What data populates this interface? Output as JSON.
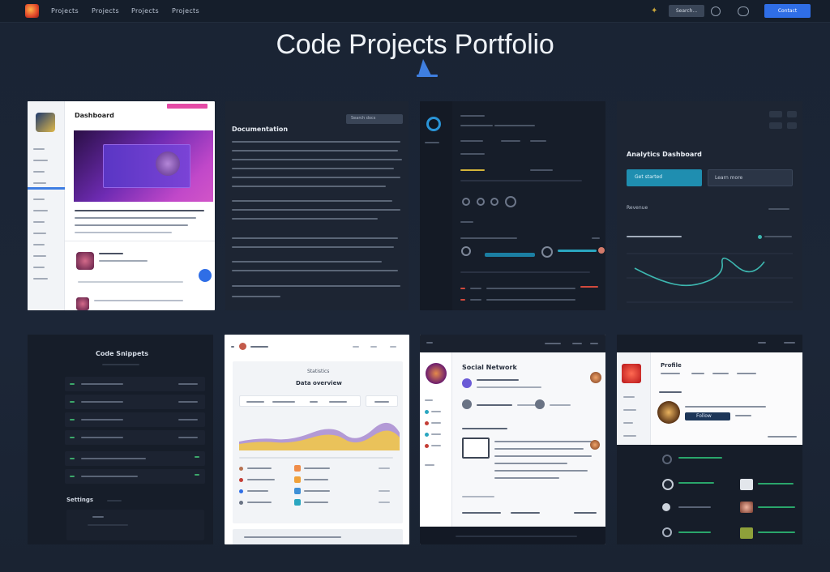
{
  "nav": {
    "links": [
      "Projects",
      "Projects",
      "Projects",
      "Projects"
    ],
    "search_label": "Search...",
    "cta_label": "Contact"
  },
  "page": {
    "title": "Code Projects Portfolio"
  },
  "cards": {
    "c1": {
      "heading": "Dashboard"
    },
    "c2": {
      "heading": "Documentation",
      "chip": "Search docs"
    },
    "c4": {
      "heading": "Analytics Dashboard",
      "primary": "Get started",
      "secondary": "Learn more",
      "metric": "Revenue"
    },
    "c5": {
      "heading": "Code Snippets",
      "section": "Settings"
    },
    "c6": {
      "heading": "Statistics",
      "subheading": "Data overview"
    },
    "c7": {
      "heading": "Social Network"
    },
    "c8": {
      "heading": "Profile",
      "button": "Follow"
    }
  },
  "colors": {
    "accent": "#2f6ee6",
    "teal": "#2aa6c0",
    "purple": "#8b3cc7",
    "yellow": "#e9c25a"
  }
}
